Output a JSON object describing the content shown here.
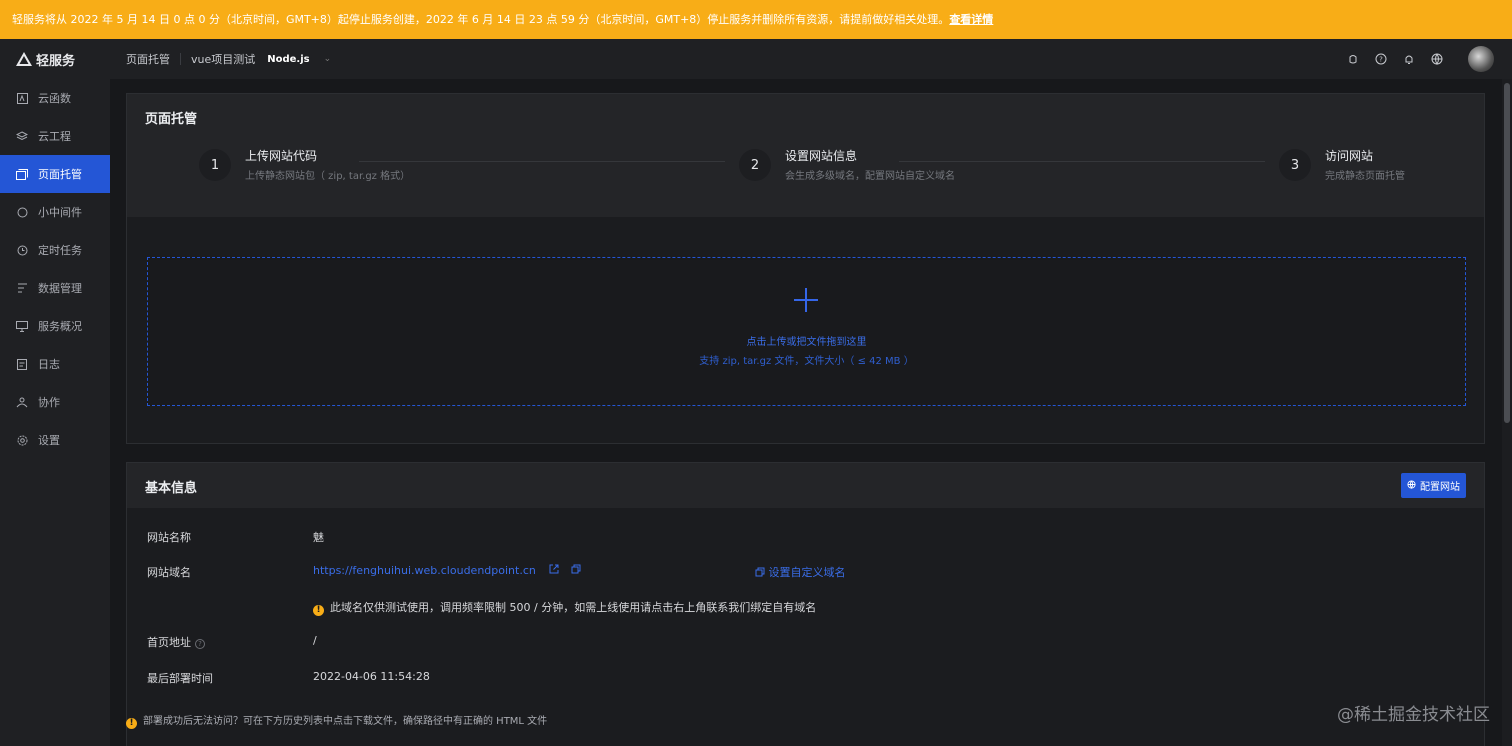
{
  "banner": {
    "text": "轻服务将从 2022 年 5 月 14 日 0 点 0 分（北京时间，GMT+8）起停止服务创建，2022 年 6 月 14 日 23 点 59 分（北京时间，GMT+8）停止服务并删除所有资源，请提前做好相关处理。",
    "link": "查看详情"
  },
  "sidebar": {
    "brand": "轻服务",
    "items": [
      {
        "label": "云函数",
        "icon": "function-icon"
      },
      {
        "label": "云工程",
        "icon": "layers-icon"
      },
      {
        "label": "页面托管",
        "icon": "pages-icon"
      },
      {
        "label": "小中间件",
        "icon": "middleware-icon"
      },
      {
        "label": "定时任务",
        "icon": "clock-icon"
      },
      {
        "label": "数据管理",
        "icon": "list-icon"
      },
      {
        "label": "服务概况",
        "icon": "monitor-icon"
      },
      {
        "label": "日志",
        "icon": "doc-icon"
      },
      {
        "label": "协作",
        "icon": "collab-icon"
      },
      {
        "label": "设置",
        "icon": "gear-icon"
      }
    ],
    "active_index": 2
  },
  "topbar": {
    "section": "页面托管",
    "project": "vue项目测试",
    "runtime": "Node.js",
    "icons": [
      "bug-icon",
      "help-icon",
      "bell-icon",
      "globe-icon"
    ]
  },
  "hosting": {
    "title": "页面托管",
    "steps": [
      {
        "num": "1",
        "title": "上传网站代码",
        "desc": "上传静态网站包（ zip, tar.gz 格式）"
      },
      {
        "num": "2",
        "title": "设置网站信息",
        "desc": "会生成多级域名，配置网站自定义域名"
      },
      {
        "num": "3",
        "title": "访问网站",
        "desc": "完成静态页面托管"
      }
    ],
    "upload": {
      "line1": "点击上传或把文件拖到这里",
      "line2": "支持 zip, tar.gz 文件，文件大小（ ≤ 42 MB ）"
    }
  },
  "basic": {
    "title": "基本信息",
    "config_button": "配置网站",
    "name_label": "网站名称",
    "name_value": "魅",
    "domain_label": "网站域名",
    "domain_value": "https://fenghuihui.web.cloudendpoint.cn",
    "custom_domain": "设置自定义域名",
    "domain_warning": "此域名仅供测试使用，调用频率限制 500 / 分钟，如需上线使用请点击右上角联系我们绑定自有域名",
    "home_label": "首页地址",
    "home_value": "/",
    "deploy_label": "最后部署时间",
    "deploy_value": "2022-04-06 11:54:28"
  },
  "footnote": "部署成功后无法访问？可在下方历史列表中点击下载文件，确保路径中有正确的 HTML 文件",
  "watermark": "@稀土掘金技术社区",
  "colors": {
    "accent": "#2456d6",
    "banner": "#f8ad17",
    "background": "#17181b",
    "panel": "#242528"
  }
}
